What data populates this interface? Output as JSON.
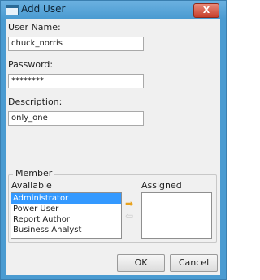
{
  "window": {
    "title": "Add User",
    "close_label": "X",
    "icons": {
      "app": "window-icon",
      "close": "close-icon"
    }
  },
  "form": {
    "username_label": "User Name:",
    "username_value": "chuck_norris",
    "password_label": "Password:",
    "password_value": "********",
    "description_label": "Description:",
    "description_value": "only_one"
  },
  "member": {
    "group_label": "Member",
    "available_label": "Available",
    "assigned_label": "Assigned",
    "available_items": [
      "Administrator",
      "Power User",
      "Report Author",
      "Business Analyst"
    ],
    "selected_index": 0,
    "assigned_items": [],
    "add_arrow": "➡",
    "remove_arrow": "⇦"
  },
  "buttons": {
    "ok": "OK",
    "cancel": "Cancel"
  },
  "colors": {
    "titlebar": "#4a9bd1",
    "selection": "#3399ff",
    "add_arrow": "#e8a21e",
    "close_button": "#c7402c"
  }
}
